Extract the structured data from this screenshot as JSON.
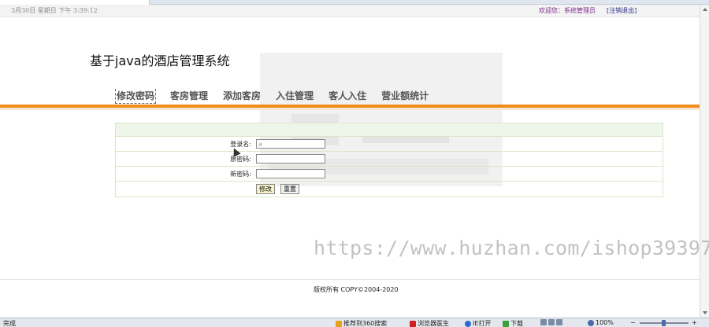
{
  "topbar": {
    "date": "3月30日 星期日 下午 3:39:12",
    "welcome": "欢迎您：系统管理员",
    "logout": "[注销退出]"
  },
  "site": {
    "title": "基于java的酒店管理系统"
  },
  "nav": {
    "items": [
      {
        "label": "修改密码"
      },
      {
        "label": "客房管理"
      },
      {
        "label": "添加客房"
      },
      {
        "label": "入住管理"
      },
      {
        "label": "客人入住"
      },
      {
        "label": "营业额统计"
      }
    ]
  },
  "form": {
    "username_label": "登录名:",
    "username_value": "a",
    "old_password_label": "原密码:",
    "new_password_label": "新密码:",
    "submit_label": "修改",
    "reset_label": "重置"
  },
  "watermark": "https://www.huzhan.com/ishop39397",
  "footer": {
    "text": "版权所有  COPY©2004-2020"
  },
  "statusbar": {
    "status": "完成",
    "recommend": "推荐到360搜索",
    "doctor": "浏览器医生",
    "ie_open": "IE打开",
    "download": "下载",
    "zoom": "100%"
  },
  "colors": {
    "accent": "#f08c1c",
    "table_border": "#d7e7c8",
    "header_fill": "#eef6ea"
  }
}
